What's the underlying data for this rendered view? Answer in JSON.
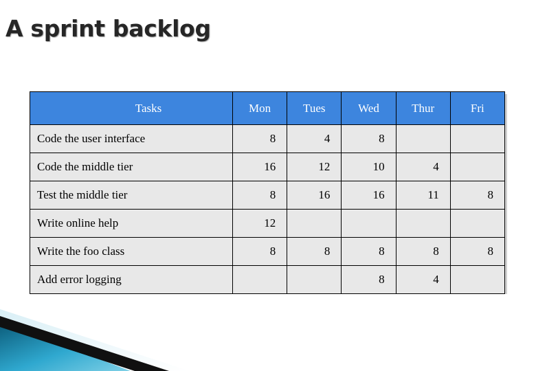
{
  "slide": {
    "title": "A sprint backlog"
  },
  "table": {
    "headers": [
      "Tasks",
      "Mon",
      "Tues",
      "Wed",
      "Thur",
      "Fri"
    ],
    "rows": [
      {
        "task": "Code the user interface",
        "values": [
          "8",
          "4",
          "8",
          "",
          ""
        ]
      },
      {
        "task": "Code the middle tier",
        "values": [
          "16",
          "12",
          "10",
          "4",
          ""
        ]
      },
      {
        "task": "Test the middle tier",
        "values": [
          "8",
          "16",
          "16",
          "11",
          "8"
        ]
      },
      {
        "task": "Write online help",
        "values": [
          "12",
          "",
          "",
          "",
          ""
        ]
      },
      {
        "task": "Write the foo class",
        "values": [
          "8",
          "8",
          "8",
          "8",
          "8"
        ]
      },
      {
        "task": "Add error logging",
        "values": [
          "",
          "",
          "8",
          "4",
          ""
        ]
      }
    ]
  },
  "theme": {
    "header_fill": "#3d85de",
    "cell_fill": "#e8e8e8",
    "title_color": "#262626",
    "deco_dark": "#0a5a78",
    "deco_mid": "#2fa8cf",
    "deco_light": "#b9e3ef",
    "deco_black": "#101010"
  },
  "decoration": {
    "name": "corner-ribbon-graphic"
  }
}
